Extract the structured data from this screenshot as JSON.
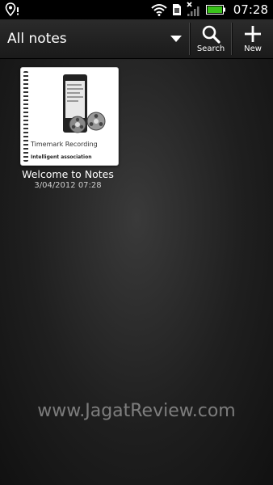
{
  "status_bar": {
    "location_icon": "location-pin-icon",
    "icons": [
      "wifi-icon",
      "sim-card-icon",
      "no-signal-icon",
      "battery-icon"
    ],
    "battery_color": "#39c21a",
    "time": "07:28"
  },
  "action_bar": {
    "view_selector_label": "All notes",
    "search_label": "Search",
    "new_label": "New"
  },
  "notes": [
    {
      "title": "Welcome to Notes",
      "date": "3/04/2012 07:28",
      "preview_line1": "Timemark Recording",
      "preview_line2": "Intelligent association"
    }
  ],
  "watermark": "www.JagatReview.com"
}
